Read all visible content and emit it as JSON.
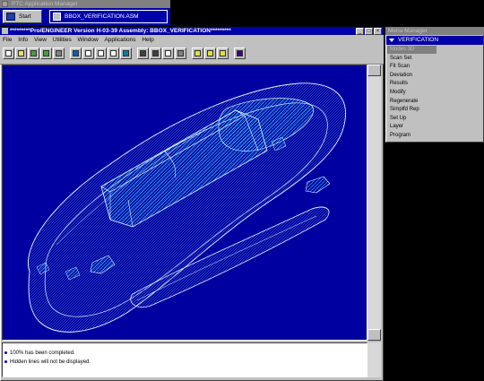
{
  "app_manager": {
    "title": "PTC Application Manager",
    "start_label": "Start",
    "task_label": "BBOX_VERIFICATION.ASM"
  },
  "window": {
    "title": "*********Pro/ENGINEER Version H-03-39 Assembly: BBOX_VERIFICATION*********",
    "controls": {
      "minimize": "_",
      "maximize": "□",
      "close": "×"
    }
  },
  "menubar": [
    {
      "label": "File"
    },
    {
      "label": "Info"
    },
    {
      "label": "View"
    },
    {
      "label": "Utilities"
    },
    {
      "label": "Window"
    },
    {
      "label": "Applications"
    },
    {
      "label": "Help"
    }
  ],
  "toolbar_icons": [
    "new-icon",
    "open-icon",
    "save-icon",
    "save-as-icon",
    "print-icon",
    "repaint-icon",
    "zoom-in-icon",
    "zoom-out-icon",
    "refit-icon",
    "orient-icon",
    "wireframe-icon",
    "hidden-line-icon",
    "no-hidden-icon",
    "shading-icon",
    "datum-planes-icon",
    "datum-axes-icon",
    "datum-points-icon",
    "help-arrow-icon"
  ],
  "messages": [
    "100% has been completed.",
    "Hidden lines will not be displayed."
  ],
  "menu_manager": {
    "title": "Menu Manager",
    "header": "VERIFICATION",
    "items": [
      {
        "label": "Modes 3D",
        "selected": true
      },
      {
        "label": "Scan Set",
        "selected": false
      },
      {
        "label": "Fit Scan",
        "selected": false
      },
      {
        "label": "Deviation",
        "selected": false
      },
      {
        "label": "Results",
        "selected": false
      },
      {
        "label": "Modify",
        "selected": false
      },
      {
        "label": "Regenerate",
        "selected": false
      },
      {
        "label": "Simplfd Rep",
        "selected": false
      },
      {
        "label": "Set Up",
        "selected": false
      },
      {
        "label": "Layer",
        "selected": false
      },
      {
        "label": "Program",
        "selected": false
      }
    ]
  },
  "colors": {
    "viewport_bg": "#0000a0",
    "wireframe": "#e8f4ff",
    "scan_points": "#30d8ff",
    "title_active": "#0000a8"
  }
}
